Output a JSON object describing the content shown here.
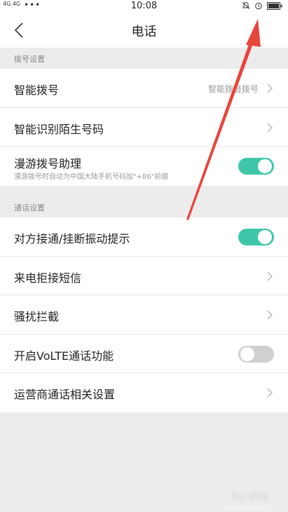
{
  "status": {
    "network": "4G 4G",
    "dots": "•••",
    "time": "10:08",
    "icons": [
      "bell-off-icon",
      "alarm-clock-icon",
      "battery-icon"
    ]
  },
  "nav": {
    "title": "电话"
  },
  "sections": [
    {
      "header": "拨号设置",
      "rows": [
        {
          "title": "智能拨号",
          "value": "智能拨音拨号"
        },
        {
          "title": "智能识别陌生号码"
        },
        {
          "title": "漫游拨号助理",
          "subtitle": "漫游拨号时自动为中国大陆手机号码加\"+86\"前缀",
          "toggle": true
        }
      ]
    },
    {
      "header": "通话设置",
      "rows": [
        {
          "title": "对方接通/挂断振动提示",
          "toggle": true
        },
        {
          "title": "来电拒接短信"
        },
        {
          "title": "骚扰拦截"
        },
        {
          "title": "开启VoLTE通话功能",
          "toggle": false
        },
        {
          "title": "运营商通话相关设置"
        }
      ]
    }
  ],
  "watermark": {
    "text": "Bai 经验",
    "sub": "jingyan.baidu.com"
  },
  "colors": {
    "toggle_on": "#3dc7a8",
    "toggle_off": "#d0d0d0",
    "arrow": "#e8453c"
  }
}
